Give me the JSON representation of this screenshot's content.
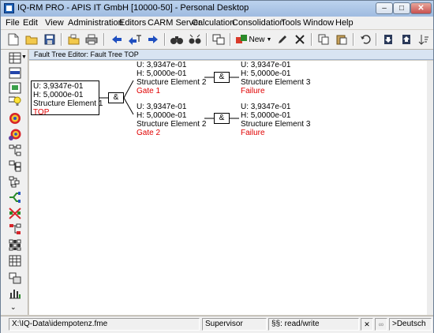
{
  "window": {
    "title": "IQ-RM PRO - APIS IT GmbH [10000-50] - Personal Desktop",
    "min_glyph": "–",
    "max_glyph": "□",
    "close_glyph": "✕"
  },
  "menu": {
    "items": [
      "File",
      "Edit",
      "View",
      "Administration",
      "Editors",
      "CARM Server",
      "Calculation",
      "Consolidation",
      "Tools",
      "Window",
      "Help"
    ]
  },
  "toolbar": {
    "new_label": "New",
    "icons": [
      "new-document-icon",
      "open-folder-icon",
      "save-icon",
      "import-icon",
      "print-icon",
      "arrow-left-icon",
      "arrow-sort-icon",
      "arrow-right-icon",
      "binoculars-icon",
      "binoculars-replace-icon",
      "layout-icon",
      "new-item-icon",
      "pencil-icon",
      "delete-icon",
      "copy-icon",
      "paste-icon",
      "undo-icon",
      "download-icon",
      "export-icon",
      "sort-icon"
    ]
  },
  "left_toolbar": {
    "icons": [
      "grid-view-icon",
      "list-view-icon",
      "tree-edit-icon",
      "lightbulb-icon",
      "target-icon",
      "target-add-icon",
      "hierarchy-icon",
      "tree-icon",
      "tree-small-icon",
      "fork-icon",
      "network-icon",
      "hierarchy-red-icon",
      "matrix-icon",
      "table-icon",
      "layers-icon",
      "bar-chart-icon"
    ]
  },
  "editor": {
    "title": "Fault Tree Editor: Fault Tree TOP",
    "top_node": {
      "u": "U: 3,9347e-01",
      "h": "H: 5,0000e-01",
      "name": "Structure Element 1",
      "label": "TOP"
    },
    "gates": [
      {
        "u": "U: 3,9347e-01",
        "h": "H: 5,0000e-01",
        "name": "Structure Element 2",
        "label": "Gate 1"
      },
      {
        "u": "U: 3,9347e-01",
        "h": "H: 5,0000e-01",
        "name": "Structure Element 2",
        "label": "Gate 2"
      }
    ],
    "leaves": [
      {
        "u": "U: 3,9347e-01",
        "h": "H: 5,0000e-01",
        "name": "Structure Element 3",
        "label": "Failure"
      },
      {
        "u": "U: 3,9347e-01",
        "h": "H: 5,0000e-01",
        "name": "Structure Element 3",
        "label": "Failure"
      }
    ],
    "gate_symbol": "&"
  },
  "status": {
    "path": "X:\\IQ-Data\\idempotenz.fme",
    "user": "Supervisor",
    "mode": "§§: read/write",
    "language": ">Deutsch"
  }
}
